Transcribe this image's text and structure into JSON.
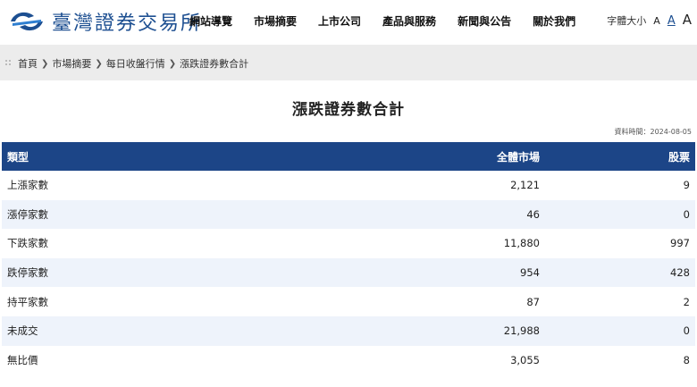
{
  "header": {
    "logo_text": "臺灣證券交易所",
    "nav": [
      {
        "label": "網站導覽",
        "name": "nav-site-guide"
      },
      {
        "label": "市場摘要",
        "name": "nav-market-summary"
      },
      {
        "label": "上市公司",
        "name": "nav-listed-companies"
      },
      {
        "label": "產品與服務",
        "name": "nav-products-services"
      },
      {
        "label": "新聞與公告",
        "name": "nav-news-announcements"
      },
      {
        "label": "關於我們",
        "name": "nav-about-us"
      }
    ],
    "font_size_label": "字體大小",
    "font_size_options": [
      "A",
      "A",
      "A"
    ]
  },
  "colors": {
    "brand": "#1d4f91",
    "table_header": "#1c4587",
    "row_alt": "#eef3fb",
    "breadcrumb_bg": "#ececec"
  },
  "breadcrumb": [
    "首頁",
    "市場摘要",
    "每日收盤行情",
    "漲跌證券數合計"
  ],
  "page": {
    "title": "漲跌證券數合計",
    "data_date": "資料時間：2024-08-05"
  },
  "table": {
    "headers": {
      "type": "類型",
      "all_market": "全體市場",
      "stock": "股票"
    },
    "rows": [
      {
        "type": "上漲家數",
        "all_market": "2,121",
        "stock": "9"
      },
      {
        "type": "漲停家數",
        "all_market": "46",
        "stock": "0"
      },
      {
        "type": "下跌家數",
        "all_market": "11,880",
        "stock": "997"
      },
      {
        "type": "跌停家數",
        "all_market": "954",
        "stock": "428"
      },
      {
        "type": "持平家數",
        "all_market": "87",
        "stock": "2"
      },
      {
        "type": "未成交",
        "all_market": "21,988",
        "stock": "0"
      },
      {
        "type": "無比價",
        "all_market": "3,055",
        "stock": "8"
      }
    ]
  }
}
